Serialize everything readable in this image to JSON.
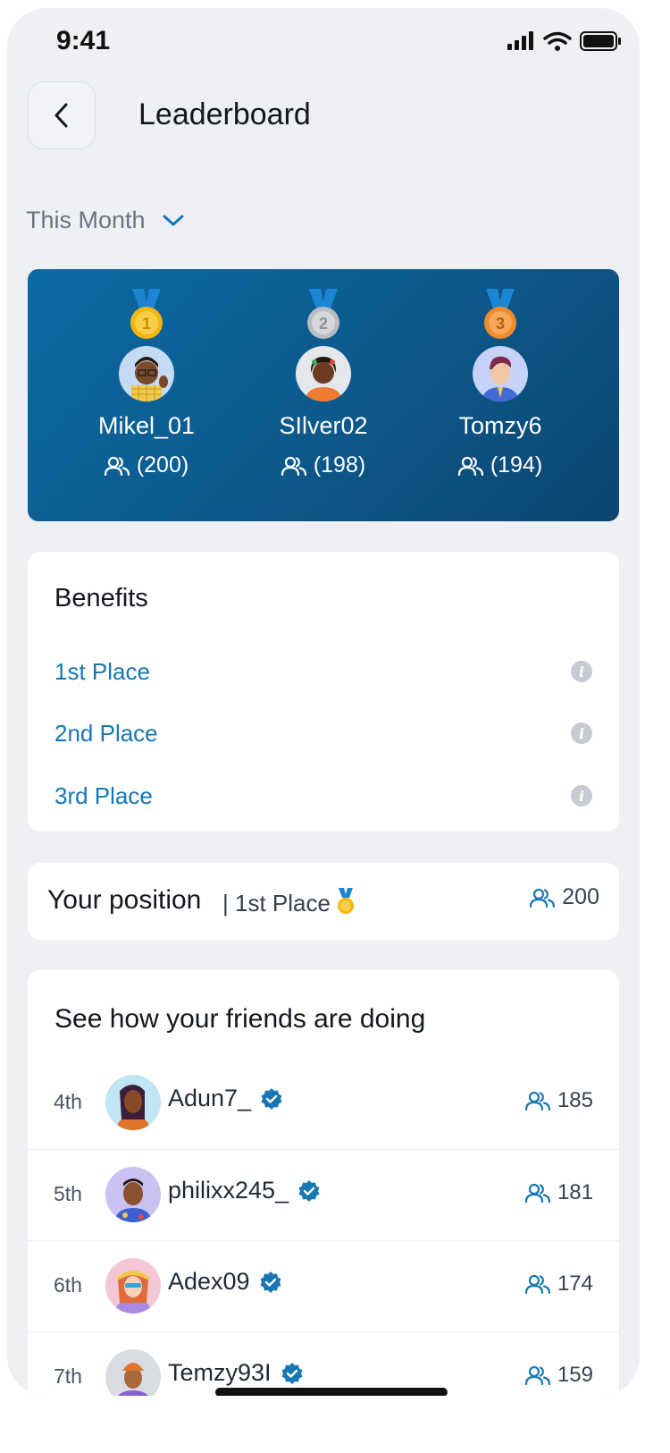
{
  "status": {
    "time": "9:41"
  },
  "header": {
    "title": "Leaderboard"
  },
  "filter": {
    "period": "This Month"
  },
  "top3": [
    {
      "rank": 1,
      "medal_color": "#f5b70f",
      "name": "Mikel_01",
      "count": "(200)"
    },
    {
      "rank": 2,
      "medal_color": "#b9bcc2",
      "name": "SIlver02",
      "count": "(198)"
    },
    {
      "rank": 3,
      "medal_color": "#f08a2a",
      "name": "Tomzy6",
      "count": "(194)"
    }
  ],
  "benefits": {
    "title": "Benefits",
    "items": [
      {
        "label": "1st Place"
      },
      {
        "label": "2nd Place"
      },
      {
        "label": "3rd Place"
      }
    ]
  },
  "position": {
    "label": "Your position",
    "rank": "| 1st Place",
    "count": "200"
  },
  "friends": {
    "title": "See how your friends are doing",
    "items": [
      {
        "rank": "4th",
        "name": "Adun7_",
        "count": "185",
        "avatar_bg": "#bfe6f2"
      },
      {
        "rank": "5th",
        "name": "philixx245_",
        "count": "181",
        "avatar_bg": "#c9c2f2"
      },
      {
        "rank": "6th",
        "name": "Adex09",
        "count": "174",
        "avatar_bg": "#f5c7d4"
      },
      {
        "rank": "7th",
        "name": "Temzy93I",
        "count": "159",
        "avatar_bg": "#d9dce3"
      }
    ]
  },
  "colors": {
    "accent": "#1677b3",
    "hero": "#0a5e93"
  }
}
